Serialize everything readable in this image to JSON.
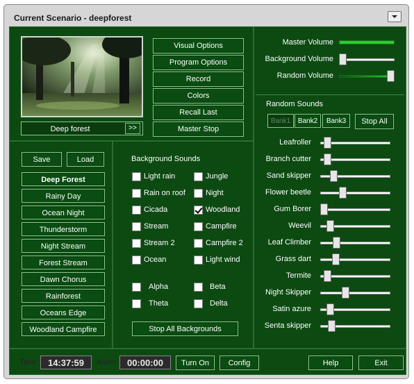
{
  "window": {
    "title": "Current Scenario - deepforest"
  },
  "scene": {
    "name": "Deep forest",
    "next_label": ">>"
  },
  "options": [
    {
      "label": "Visual Options"
    },
    {
      "label": "Program Options"
    },
    {
      "label": "Record"
    },
    {
      "label": "Colors"
    },
    {
      "label": "Recall Last"
    },
    {
      "label": "Master Stop"
    }
  ],
  "volume": {
    "master_label": "Master Volume",
    "background_label": "Background Volume",
    "random_label": "Random Volume",
    "master_level": 1.0,
    "background_level": 0.0,
    "random_level": 1.0
  },
  "presets": {
    "save_label": "Save",
    "load_label": "Load",
    "items": [
      {
        "label": "Deep Forest"
      },
      {
        "label": "Rainy Day"
      },
      {
        "label": "Ocean Night"
      },
      {
        "label": "Thunderstorm"
      },
      {
        "label": "Night Stream"
      },
      {
        "label": "Forest Stream"
      },
      {
        "label": "Dawn Chorus"
      },
      {
        "label": "Rainforest"
      },
      {
        "label": "Oceans Edge"
      },
      {
        "label": "Woodland Campfire"
      }
    ]
  },
  "background": {
    "heading": "Background Sounds",
    "left": [
      {
        "label": "Light rain",
        "checked": false
      },
      {
        "label": "Rain on roof",
        "checked": false
      },
      {
        "label": "Cicada",
        "checked": false
      },
      {
        "label": "Stream",
        "checked": false
      },
      {
        "label": "Stream 2",
        "checked": false
      },
      {
        "label": "Ocean",
        "checked": false
      }
    ],
    "right": [
      {
        "label": "Jungle",
        "checked": false
      },
      {
        "label": "Night",
        "checked": false
      },
      {
        "label": "Woodland",
        "checked": true
      },
      {
        "label": "Campfire",
        "checked": false
      },
      {
        "label": "Campfire 2",
        "checked": false
      },
      {
        "label": "Light wind",
        "checked": false
      }
    ],
    "waves": [
      {
        "label": "Alpha",
        "checked": false
      },
      {
        "label": "Beta",
        "checked": false
      },
      {
        "label": "Theta",
        "checked": false
      },
      {
        "label": "Delta",
        "checked": false
      }
    ],
    "stop_all_label": "Stop All Backgrounds"
  },
  "random": {
    "heading": "Random Sounds",
    "banks": [
      {
        "label": "Bank1",
        "active": true
      },
      {
        "label": "Bank2",
        "active": false
      },
      {
        "label": "Bank3",
        "active": false
      }
    ],
    "stop_all_label": "Stop All",
    "sounds": [
      {
        "label": "Leafroller",
        "level": 0.06
      },
      {
        "label": "Branch cutter",
        "level": 0.06
      },
      {
        "label": "Sand skipper",
        "level": 0.16
      },
      {
        "label": "Flower beetle",
        "level": 0.3
      },
      {
        "label": "Gum Borer",
        "level": 0.0
      },
      {
        "label": "Weevil",
        "level": 0.1
      },
      {
        "label": "Leaf Climber",
        "level": 0.2
      },
      {
        "label": "Grass dart",
        "level": 0.19
      },
      {
        "label": "Termite",
        "level": 0.05
      },
      {
        "label": "Night Skipper",
        "level": 0.35
      },
      {
        "label": "Satin azure",
        "level": 0.1
      },
      {
        "label": "Senta skipper",
        "level": 0.12
      }
    ]
  },
  "footer": {
    "time_label": "Time:",
    "time_value": "14:37:59",
    "alarm_label": "Alarm:",
    "alarm_value": "00:00:00",
    "turn_on_label": "Turn On",
    "config_label": "Config",
    "help_label": "Help",
    "exit_label": "Exit"
  },
  "colors": {
    "panel": "#0c4a12",
    "button": "#0a4c12",
    "volume_fill": "#2ecc2e"
  }
}
